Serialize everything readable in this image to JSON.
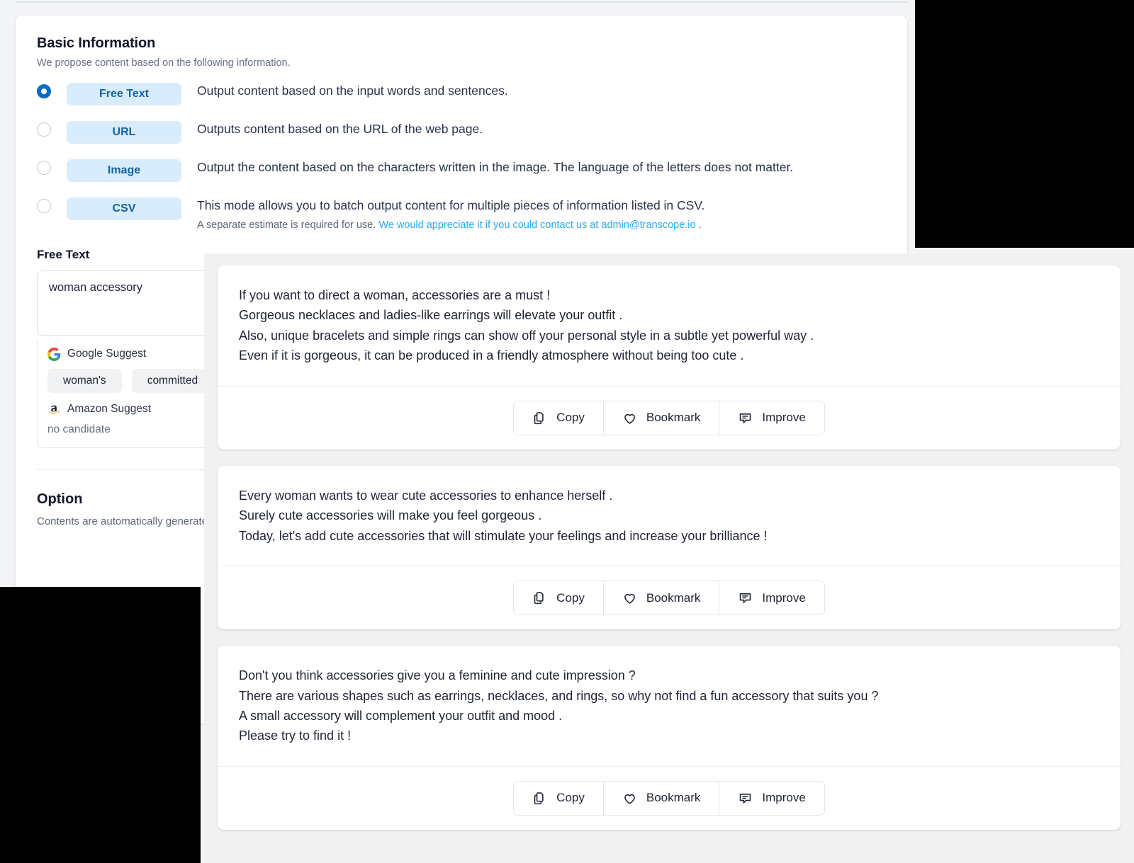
{
  "basic_information": {
    "title": "Basic Information",
    "subtitle": "We propose content based on the following information.",
    "modes": [
      {
        "badge": "Free Text",
        "description": "Output content based on the input words and sentences.",
        "selected": true,
        "note": "",
        "note_link": "",
        "note_tail": ""
      },
      {
        "badge": "URL",
        "description": "Outputs content based on the URL of the web page.",
        "selected": false,
        "note": "",
        "note_link": "",
        "note_tail": ""
      },
      {
        "badge": "Image",
        "description": "Output the content based on the characters written in the image. The language of the letters does not matter.",
        "selected": false,
        "note": "",
        "note_link": "",
        "note_tail": ""
      },
      {
        "badge": "CSV",
        "description": "This mode allows you to batch output content for multiple pieces of information listed in CSV.",
        "selected": false,
        "note": "A separate estimate is required for use. ",
        "note_link": "We would appreciate it if you could contact us at admin@transcope.io",
        "note_tail": " ."
      }
    ]
  },
  "free_text": {
    "label": "Free Text",
    "value": "woman accessory",
    "placeholder": "",
    "google_suggest": {
      "label": "Google Suggest",
      "icon": "google-icon",
      "chips": [
        "woman's",
        "committed"
      ]
    },
    "amazon_suggest": {
      "label": "Amazon Suggest",
      "icon": "amazon-icon",
      "empty_text": "no candidate"
    }
  },
  "option": {
    "title": "Option",
    "subtitle": "Contents are automatically generated in the selected language."
  },
  "results": {
    "actions": [
      {
        "label": "Copy",
        "icon": "copy-icon"
      },
      {
        "label": "Bookmark",
        "icon": "heart-icon"
      },
      {
        "label": "Improve",
        "icon": "comment-icon"
      }
    ],
    "cards": [
      {
        "lines": [
          "If you want to direct a woman, accessories are a must !",
          "Gorgeous necklaces and ladies-like earrings will elevate your outfit .",
          "Also, unique bracelets and simple rings can show off your personal style in a subtle yet powerful way .",
          "Even if it is gorgeous, it can be produced in a friendly atmosphere without being too cute ."
        ]
      },
      {
        "lines": [
          "Every woman wants to wear cute accessories to enhance herself .",
          "Surely cute accessories will make you feel gorgeous .",
          "Today, let's add cute accessories that will stimulate your feelings and increase your brilliance !"
        ]
      },
      {
        "lines": [
          "Don't you think accessories give you a feminine and cute impression ?",
          "There are various shapes such as earrings, necklaces, and rings, so why not find a fun accessory that suits you ?",
          "A small accessory will complement your outfit and mood .",
          "Please try to find it !"
        ]
      }
    ]
  },
  "colors": {
    "accent_blue": "#0b6bc4",
    "badge_bg": "#d8ecfb",
    "badge_text": "#1263a0",
    "link_blue": "#29a9f6",
    "panel_bg": "#f1f1f2",
    "text_dark": "#1d2433"
  }
}
